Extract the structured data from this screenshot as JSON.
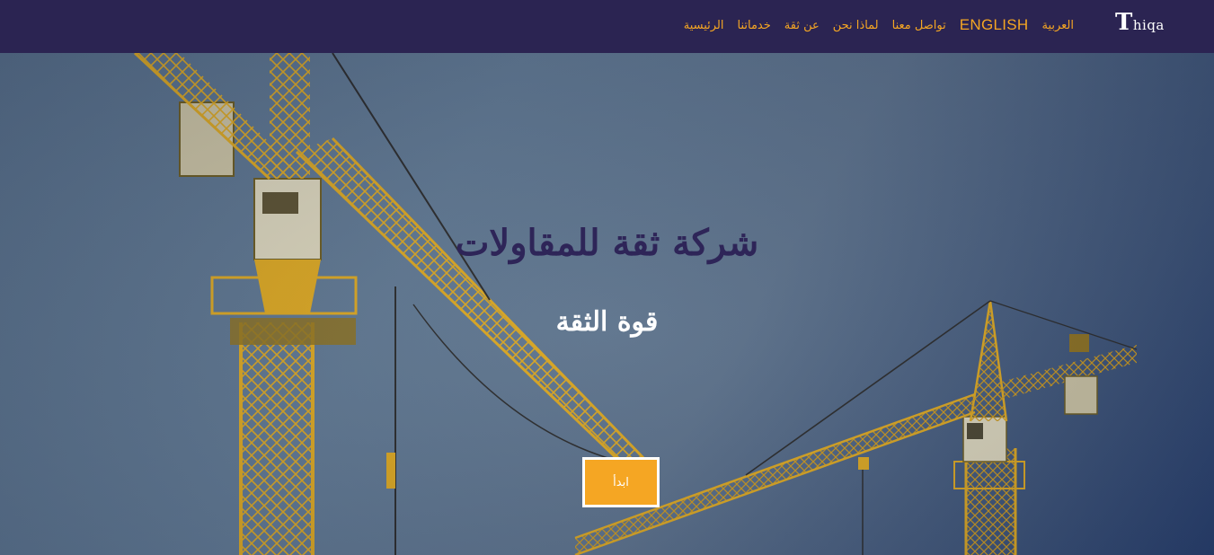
{
  "brand": {
    "logo_initial": "T",
    "logo_rest": "hiqa"
  },
  "nav": {
    "items": [
      {
        "label": "الرئيسية"
      },
      {
        "label": "خدماتنا"
      },
      {
        "label": "عن ثقة"
      },
      {
        "label": "لماذا نحن"
      },
      {
        "label": "تواصل معنا"
      },
      {
        "label": "ENGLISH"
      },
      {
        "label": "العربية"
      }
    ]
  },
  "hero": {
    "title": "شركة ثقة للمقاولات",
    "subtitle": "قوة الثقة",
    "cta_label": "ابدأ"
  },
  "colors": {
    "navbar_bg": "#2b2452",
    "accent": "#f5a623",
    "title_color": "#2e2558",
    "crane_yellow": "#d9a520"
  },
  "icons": {
    "background": "construction-cranes-photo"
  }
}
